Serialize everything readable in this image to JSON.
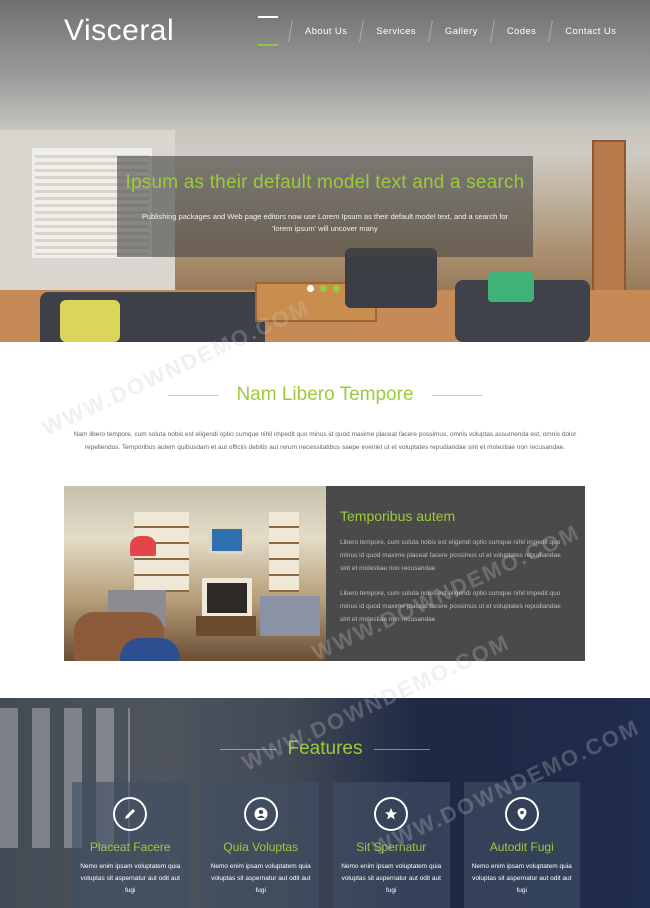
{
  "header": {
    "brand": "Visceral",
    "nav": [
      "About Us",
      "Services",
      "Gallery",
      "Codes",
      "Contact Us"
    ]
  },
  "hero": {
    "title": "Ipsum as their default model text and a search",
    "text": "Publishing packages and Web page editors now use Lorem Ipsum as their default model text, and a search for 'lorem ipsum' will uncover many"
  },
  "about": {
    "title": "Nam Libero Tempore",
    "body": "Nam libero tempore, cum soluta nobis est eligendi optio cumque nihil impedit quo minus id quod maxime placeat facere possimus, omnis voluptas assumenda est, omnis dolor repellendus. Temporibus autem quibusdam et aut officiis debitis aut rerum necessitatibus saepe eveniet ut et voluptates repudiandae sint et molestiae non recusandae.",
    "feature": {
      "title": "Temporibus autem",
      "p1": "Libero tempore, cum soluta nobis est eligendi optio cumque nihil impedit quo minus id quod maxime placeat facere possimus ut et voluptates repudiandae sint et molestiae non recusandae",
      "p2": "Libero tempore, cum soluta nobis est eligendi optio cumque nihil impedit quo minus id quod maxime placeat facere possimus ut et voluptates repudiandae sint et molestiae non recusandae"
    }
  },
  "features": {
    "title": "Features",
    "cards": [
      {
        "title": "Placeat Facere",
        "text": "Nemo enim ipsam voluptatem quia voluptas sit aspernatur aut odit aut fugi",
        "icon": "pencil-icon"
      },
      {
        "title": "Quia Voluptas",
        "text": "Nemo enim ipsam voluptatem quia voluptas sit aspernatur aut odit aut fugi",
        "icon": "user-icon"
      },
      {
        "title": "Sit Spernatur",
        "text": "Nemo enim ipsam voluptatem quia voluptas sit aspernatur aut odit aut fugi",
        "icon": "star-icon"
      },
      {
        "title": "Autodit Fugi",
        "text": "Nemo enim ipsam voluptatem quia voluptas sit aspernatur aut odit aut fugi",
        "icon": "map-marker-icon"
      }
    ]
  },
  "watermark": {
    "text1": "WWW.DOWNDEMO.COM",
    "text2": "WWW.DOWNDEMO.COM",
    "text3": "WWW.DOWNDEMO.COM",
    "text4": "WWW.DOWNDEMO.COM"
  },
  "colors": {
    "accent": "#9bcb3c",
    "dark_box": "#4a4a4a"
  }
}
